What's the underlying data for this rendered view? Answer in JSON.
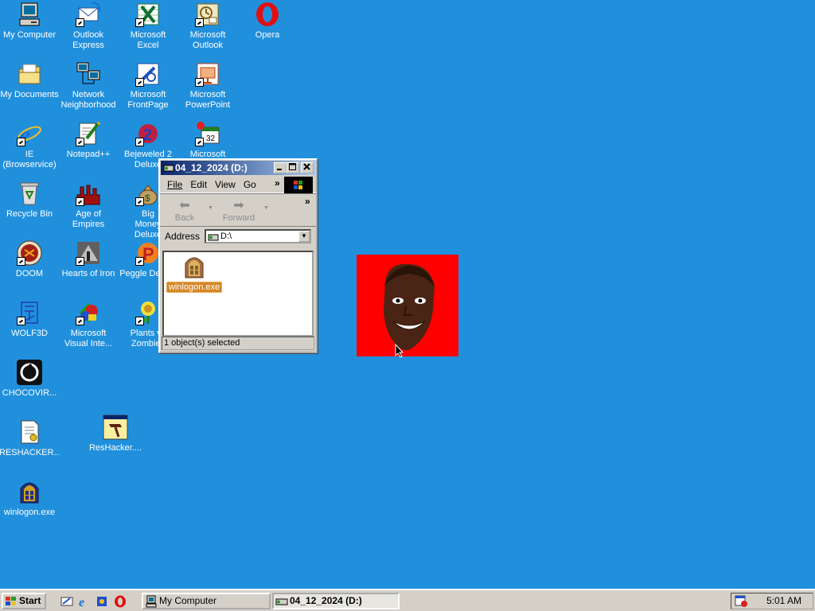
{
  "desktop": {
    "background": "#2190dc",
    "icons": [
      {
        "label": "My Computer",
        "icon": "my-computer-icon"
      },
      {
        "label": "Outlook Express",
        "icon": "outlook-express-icon"
      },
      {
        "label": "Microsoft Excel",
        "icon": "excel-icon"
      },
      {
        "label": "Microsoft Outlook",
        "icon": "outlook-icon"
      },
      {
        "label": "Opera",
        "icon": "opera-icon"
      },
      {
        "label": "My Documents",
        "icon": "folder-icon"
      },
      {
        "label": "Network Neighborhood",
        "icon": "network-icon"
      },
      {
        "label": "Microsoft FrontPage",
        "icon": "frontpage-icon"
      },
      {
        "label": "Microsoft PowerPoint",
        "icon": "powerpoint-icon"
      },
      {
        "label": "IE (Browservice)",
        "icon": "ie-icon"
      },
      {
        "label": "Notepad++",
        "icon": "notepad-icon"
      },
      {
        "label": "Bejeweled 2 Deluxe",
        "icon": "bejeweled-icon"
      },
      {
        "label": "Microsoft",
        "icon": "calendar-icon"
      },
      {
        "label": "Recycle Bin",
        "icon": "recycle-bin-icon"
      },
      {
        "label": "Age of Empires",
        "icon": "age-of-empires-icon"
      },
      {
        "label": "Big Money Deluxe",
        "icon": "money-bag-icon"
      },
      {
        "label": "DOOM",
        "icon": "doom-icon"
      },
      {
        "label": "Hearts of Iron",
        "icon": "hearts-of-iron-icon"
      },
      {
        "label": "Peggle Deluxe",
        "icon": "peggle-icon"
      },
      {
        "label": "WOLF3D",
        "icon": "wolf3d-icon"
      },
      {
        "label": "Microsoft Visual Inte...",
        "icon": "visual-interdev-icon"
      },
      {
        "label": "Plants vs Zombies",
        "icon": "plants-icon"
      },
      {
        "label": "CHOCOVIR...",
        "icon": "chocovir-icon"
      },
      {
        "label": "RESHACKER...",
        "icon": "reshacker-doc-icon"
      },
      {
        "label": "ResHacker....",
        "icon": "reshacker-icon"
      },
      {
        "label": "winlogon.exe",
        "icon": "winlogon-icon"
      }
    ]
  },
  "explorer": {
    "title": "04_12_2024 (D:)",
    "menu": [
      "File",
      "Edit",
      "View",
      "Go"
    ],
    "back_label": "Back",
    "forward_label": "Forward",
    "address_label": "Address",
    "address_value": "D:\\",
    "file_name": "winlogon.exe",
    "status": "1 object(s) selected",
    "more_glyph": "»"
  },
  "taskbar": {
    "start_label": "Start",
    "tasks": [
      {
        "label": "My Computer",
        "active": false
      },
      {
        "label": "04_12_2024 (D:)",
        "active": true
      }
    ],
    "clock": "5:01 AM"
  }
}
